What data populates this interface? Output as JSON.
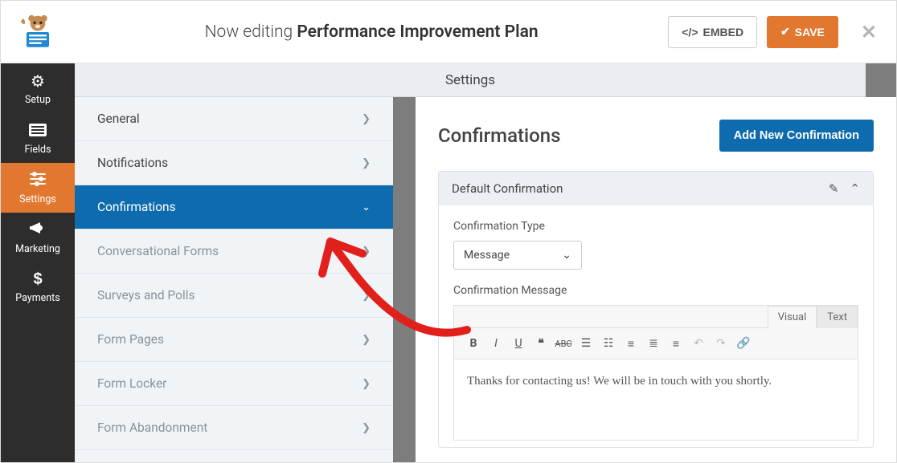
{
  "header": {
    "editing_prefix": "Now editing",
    "form_name": "Performance Improvement Plan",
    "embed_label": "EMBED",
    "save_label": "SAVE"
  },
  "sidebar": {
    "items": [
      {
        "label": "Setup",
        "icon": "gear"
      },
      {
        "label": "Fields",
        "icon": "list"
      },
      {
        "label": "Settings",
        "icon": "sliders",
        "active": true
      },
      {
        "label": "Marketing",
        "icon": "megaphone"
      },
      {
        "label": "Payments",
        "icon": "dollar"
      }
    ]
  },
  "settings_header": "Settings",
  "settings_menu": {
    "items": [
      {
        "label": "General",
        "type": "item"
      },
      {
        "label": "Notifications",
        "type": "item"
      },
      {
        "label": "Confirmations",
        "type": "active"
      },
      {
        "label": "Conversational Forms",
        "type": "sub"
      },
      {
        "label": "Surveys and Polls",
        "type": "sub"
      },
      {
        "label": "Form Pages",
        "type": "sub"
      },
      {
        "label": "Form Locker",
        "type": "sub"
      },
      {
        "label": "Form Abandonment",
        "type": "sub"
      }
    ]
  },
  "panel": {
    "title": "Confirmations",
    "add_button": "Add New Confirmation",
    "card_title": "Default Confirmation",
    "type_label": "Confirmation Type",
    "type_value": "Message",
    "message_label": "Confirmation Message",
    "editor_tabs": {
      "visual": "Visual",
      "text": "Text"
    },
    "message_value": "Thanks for contacting us! We will be in touch with you shortly."
  }
}
